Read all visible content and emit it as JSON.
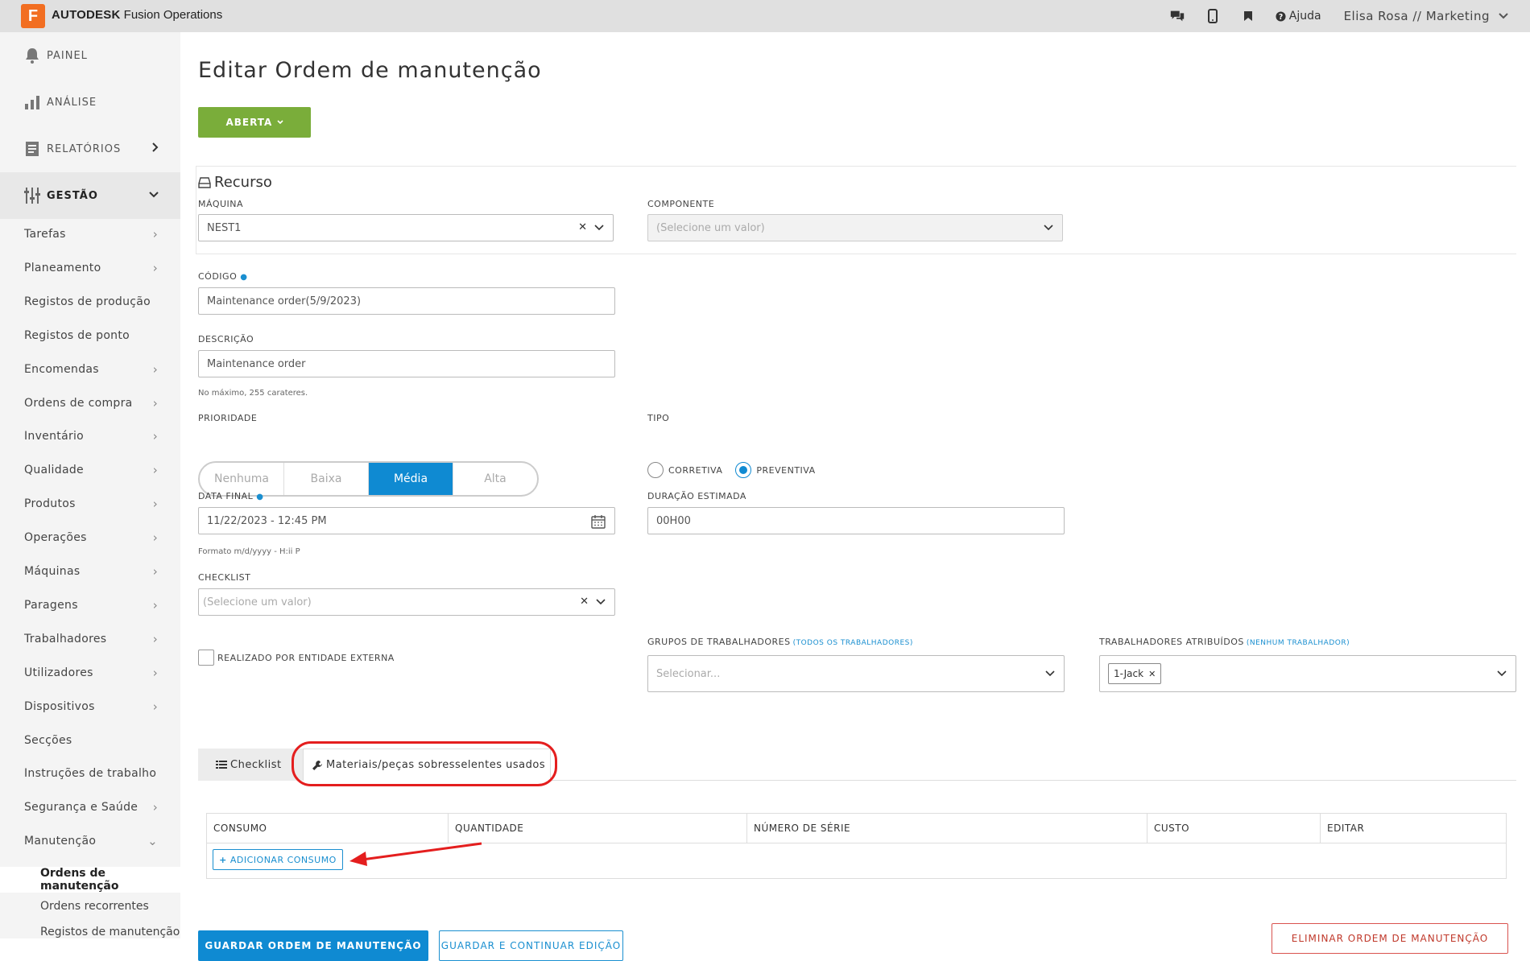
{
  "app": {
    "logo_letter": "F",
    "brand_bold": "AUTODESK",
    "brand_rest": " Fusion Operations"
  },
  "header": {
    "help_label": "Ajuda",
    "user_label": "Elisa Rosa // Marketing"
  },
  "sidebar": {
    "main": [
      {
        "label": "PAINEL",
        "icon": "bell-icon"
      },
      {
        "label": "ANÁLISE",
        "icon": "bar-chart-icon"
      },
      {
        "label": "RELATÓRIOS",
        "icon": "report-icon"
      },
      {
        "label": "GESTÃO",
        "icon": "sliders-icon"
      }
    ],
    "items": [
      {
        "label": "Tarefas",
        "has_arrow": true
      },
      {
        "label": "Planeamento",
        "has_arrow": true
      },
      {
        "label": "Registos de produção",
        "has_arrow": false
      },
      {
        "label": "Registos de ponto",
        "has_arrow": false
      },
      {
        "label": "Encomendas",
        "has_arrow": true
      },
      {
        "label": "Ordens de compra",
        "has_arrow": true
      },
      {
        "label": "Inventário",
        "has_arrow": true
      },
      {
        "label": "Qualidade",
        "has_arrow": true
      },
      {
        "label": "Produtos",
        "has_arrow": true
      },
      {
        "label": "Operações",
        "has_arrow": true
      },
      {
        "label": "Máquinas",
        "has_arrow": true
      },
      {
        "label": "Paragens",
        "has_arrow": true
      },
      {
        "label": "Trabalhadores",
        "has_arrow": true
      },
      {
        "label": "Utilizadores",
        "has_arrow": true
      },
      {
        "label": "Dispositivos",
        "has_arrow": true
      },
      {
        "label": "Secções",
        "has_arrow": false
      },
      {
        "label": "Instruções de trabalho",
        "has_arrow": false
      },
      {
        "label": "Segurança e Saúde",
        "has_arrow": true
      },
      {
        "label": "Manutenção",
        "has_arrow": true
      }
    ],
    "sub_items": [
      {
        "label": "Ordens de manutenção",
        "active": true
      },
      {
        "label": "Ordens recorrentes",
        "active": false
      },
      {
        "label": "Registos de manutenção",
        "active": false
      }
    ]
  },
  "page": {
    "title": "Editar Ordem de manutenção",
    "status_label": "ABERTA",
    "section_recurso": "Recurso"
  },
  "form": {
    "maquina_label": "MÁQUINA",
    "maquina_value": "NEST1",
    "componente_label": "COMPONENTE",
    "componente_placeholder": "(Selecione um valor)",
    "codigo_label": "CÓDIGO",
    "codigo_value": "Maintenance order(5/9/2023)",
    "descricao_label": "DESCRIÇÃO",
    "descricao_value": "Maintenance order",
    "descricao_hint": "No máximo, 255 carateres.",
    "prioridade_label": "PRIORIDADE",
    "prioridade_options": [
      "Nenhuma",
      "Baixa",
      "Média",
      "Alta"
    ],
    "prioridade_selected": "Média",
    "tipo_label": "TIPO",
    "tipo_options": [
      "CORRETIVA",
      "PREVENTIVA"
    ],
    "tipo_selected": "PREVENTIVA",
    "data_final_label": "DATA FINAL",
    "data_final_value": "11/22/2023 - 12:45 PM",
    "data_final_hint": "Formato m/d/yyyy - H:ii P",
    "duracao_label": "DURAÇÃO ESTIMADA",
    "duracao_value": "00H00",
    "checklist_label": "CHECKLIST",
    "checklist_placeholder": "(Selecione um valor)",
    "externa_label": "REALIZADO POR ENTIDADE EXTERNA",
    "grupos_label": "GRUPOS DE TRABALHADORES",
    "grupos_link": "(TODOS OS TRABALHADORES)",
    "grupos_placeholder": "Selecionar...",
    "trabalhadores_label": "TRABALHADORES ATRIBUÍDOS",
    "trabalhadores_link": "(NENHUM TRABALHADOR)",
    "trabalhadores_tag": "1-Jack"
  },
  "tabs": {
    "checklist": "Checklist",
    "materials": "Materiais/peças sobresselentes usados"
  },
  "table": {
    "columns": [
      "CONSUMO",
      "QUANTIDADE",
      "NÚMERO DE SÉRIE",
      "CUSTO",
      "EDITAR"
    ],
    "add_label": "ADICIONAR CONSUMO"
  },
  "actions": {
    "save": "GUARDAR ORDEM DE MANUTENÇÃO",
    "save_continue": "GUARDAR E CONTINUAR EDIÇÃO",
    "delete": "ELIMINAR ORDEM DE MANUTENÇÃO"
  },
  "colors": {
    "accent": "#0f8ad2",
    "status_green": "#7aad3a",
    "danger": "#c0392b",
    "annotation_red": "#e41e1e"
  }
}
